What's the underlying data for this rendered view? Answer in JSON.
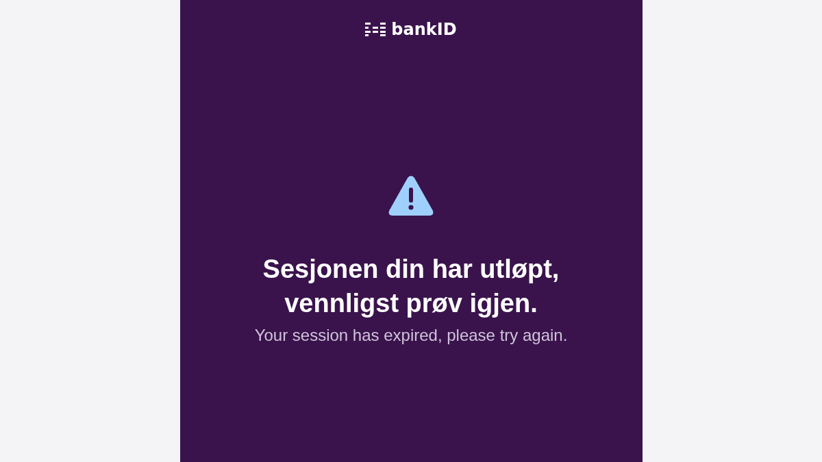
{
  "logo": {
    "text": "bankID"
  },
  "message": {
    "title_lines": [
      "Sesjonen din har utløpt,",
      "vennligst prøv igjen."
    ],
    "subtitle": "Your session has expired, please try again."
  }
}
